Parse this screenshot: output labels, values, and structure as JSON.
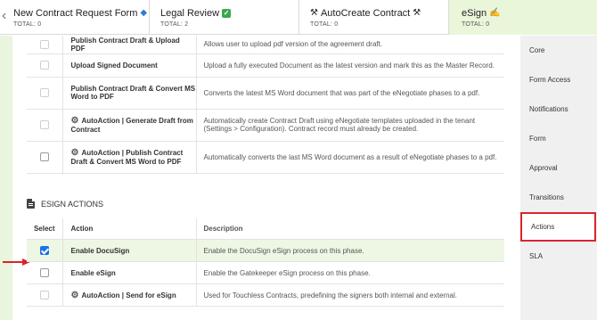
{
  "phases": [
    {
      "name": "New Contract Request Form",
      "icon": "🔹",
      "total": "TOTAL: 0"
    },
    {
      "name": "Legal Review",
      "icon": "✅",
      "total": "TOTAL: 2"
    },
    {
      "name": "AutoCreate Contract",
      "icon_left": "⚒",
      "icon": "⚒",
      "total": "TOTAL: 0"
    },
    {
      "name": "eSign",
      "icon": "✍",
      "total": "TOTAL: 0"
    }
  ],
  "actions_top": [
    {
      "label": "Publish Contract Draft & Upload PDF",
      "description": "Allows user to upload pdf version of the agreement draft.",
      "checked": false,
      "auto": false
    },
    {
      "label": "Upload Signed Document",
      "description": "Upload a fully executed Document as the latest version and mark this as the Master Record.",
      "checked": false,
      "auto": false
    },
    {
      "label": "Publish Contract Draft & Convert MS Word to PDF",
      "description": "Converts the latest MS Word document that was part of the eNegotiate phases to a pdf.",
      "checked": false,
      "auto": false
    },
    {
      "label": "AutoAction | Generate Draft from Contract",
      "description": "Automatically create Contract Draft using eNegotiate templates uploaded in the tenant (Settings > Configuration). Contract record must already be created.",
      "checked": false,
      "auto": true
    },
    {
      "label": "AutoAction | Publish Contract Draft & Convert MS Word to PDF",
      "description": "Automatically converts the last MS Word document as a result of eNegotiate phases to a pdf.",
      "checked": false,
      "auto": true
    }
  ],
  "esign_section": {
    "title": "ESIGN ACTIONS",
    "headers": {
      "select": "Select",
      "action": "Action",
      "description": "Description"
    },
    "rows": [
      {
        "label": "Enable DocuSign",
        "description": "Enable the DocuSign eSign process on this phase.",
        "checked": true,
        "auto": false
      },
      {
        "label": "Enable eSign",
        "description": "Enable the Gatekeeper eSign process on this phase.",
        "checked": false,
        "auto": false
      },
      {
        "label": "AutoAction | Send for eSign",
        "description": "Used for Touchless Contracts, predefining the signers both internal and external.",
        "checked": false,
        "auto": true
      }
    ]
  },
  "menu": {
    "items": [
      "Core",
      "Form Access",
      "Notifications",
      "Form",
      "Approval",
      "Transitions",
      "Actions",
      "SLA"
    ],
    "active": "Actions"
  },
  "colors": {
    "accent_green": "#eaf6da",
    "highlight_red": "#d8262e",
    "checkbox_blue": "#1a73e8"
  },
  "icons": {
    "prev": "chevron-left-icon",
    "gear": "gear-icon",
    "document": "document-icon",
    "arrow": "red-arrow-icon"
  }
}
